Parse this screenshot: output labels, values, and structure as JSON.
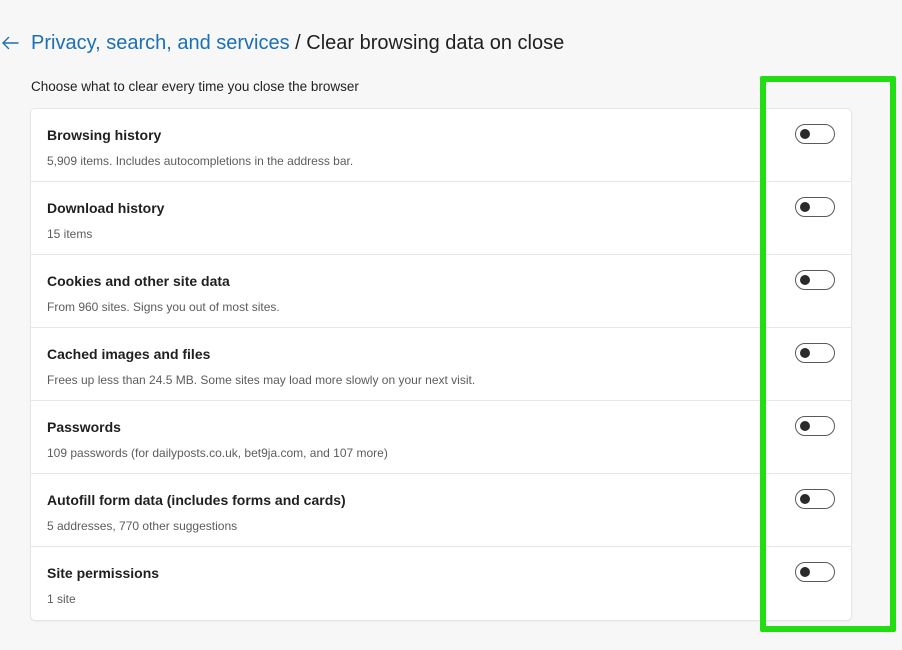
{
  "header": {
    "back_icon": "arrow-left-icon",
    "breadcrumb_parent": "Privacy, search, and services",
    "breadcrumb_separator": " / ",
    "breadcrumb_current": "Clear browsing data on close",
    "link_color": "#1a6fb5"
  },
  "subtitle": "Choose what to clear every time you close the browser",
  "items": [
    {
      "title": "Browsing history",
      "desc": "5,909 items. Includes autocompletions in the address bar.",
      "enabled": false
    },
    {
      "title": "Download history",
      "desc": "15 items",
      "enabled": false
    },
    {
      "title": "Cookies and other site data",
      "desc": "From 960 sites. Signs you out of most sites.",
      "enabled": false
    },
    {
      "title": "Cached images and files",
      "desc": "Frees up less than 24.5 MB. Some sites may load more slowly on your next visit.",
      "enabled": false
    },
    {
      "title": "Passwords",
      "desc": "109 passwords (for dailyposts.co.uk, bet9ja.com, and 107 more)",
      "enabled": false
    },
    {
      "title": "Autofill form data (includes forms and cards)",
      "desc": "5 addresses, 770 other suggestions",
      "enabled": false
    },
    {
      "title": "Site permissions",
      "desc": "1 site",
      "enabled": false
    }
  ],
  "highlight_color": "#22dd11"
}
